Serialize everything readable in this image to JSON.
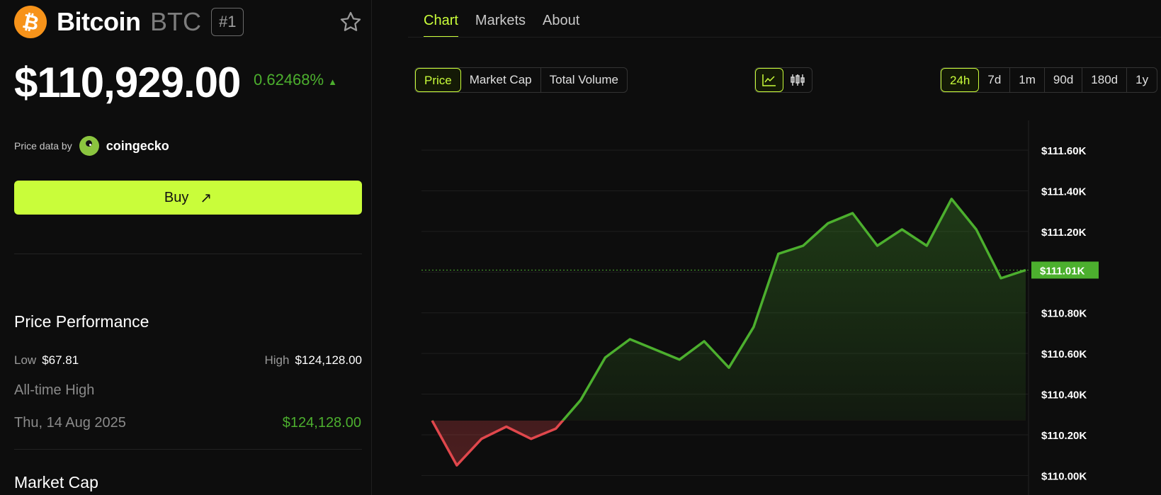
{
  "coin": {
    "logo_symbol": "₿",
    "name": "Bitcoin",
    "symbol": "BTC",
    "rank": "#1",
    "favorite_icon": "star-icon",
    "price": "$110,929.00",
    "change": "0.62468%",
    "change_arrow": "▲"
  },
  "price_data": {
    "label": "Price data by",
    "provider": "coingecko"
  },
  "buy": {
    "label": "Buy",
    "arrow": "↗"
  },
  "performance": {
    "title": "Price Performance",
    "low_label": "Low",
    "low_value": "$67.81",
    "high_label": "High",
    "high_value": "$124,128.00",
    "ath_label": "All-time High",
    "ath_date": "Thu, 14 Aug 2025",
    "ath_value": "$124,128.00"
  },
  "market_cap": {
    "title": "Market Cap"
  },
  "tabs": [
    {
      "label": "Chart",
      "active": true
    },
    {
      "label": "Markets",
      "active": false
    },
    {
      "label": "About",
      "active": false
    }
  ],
  "metric_options": [
    "Price",
    "Market Cap",
    "Total Volume"
  ],
  "metric_selected": "Price",
  "chart_types": [
    "line-chart-icon",
    "candlestick-icon"
  ],
  "range_options": [
    "24h",
    "7d",
    "1m",
    "90d",
    "180d",
    "1y"
  ],
  "range_selected": "24h",
  "colors": {
    "accent": "#c9fd3a",
    "up": "#4caf2e",
    "down": "#e0474c",
    "background": "#0d0d0d"
  },
  "chart_data": {
    "type": "line",
    "ylim": [
      110.08,
      111.68
    ],
    "yticks": [
      110.2,
      110.4,
      110.6,
      110.8,
      111.0,
      111.2,
      111.4,
      111.6
    ],
    "ytick_labels": [
      "$110.20K",
      "$110.40K",
      "$110.60K",
      "$110.80K",
      "$111.00K",
      "$111.20K",
      "$111.40K",
      "$111.60K"
    ],
    "current_value": 111.01,
    "current_label": "$111.01K",
    "baseline": 110.27,
    "grid": true,
    "values": [
      110.27,
      110.05,
      110.18,
      110.24,
      110.18,
      110.23,
      110.37,
      110.58,
      110.67,
      110.62,
      110.57,
      110.66,
      110.53,
      110.73,
      111.09,
      111.13,
      111.24,
      111.29,
      111.13,
      111.21,
      111.13,
      111.36,
      111.21,
      110.97,
      111.01
    ]
  }
}
